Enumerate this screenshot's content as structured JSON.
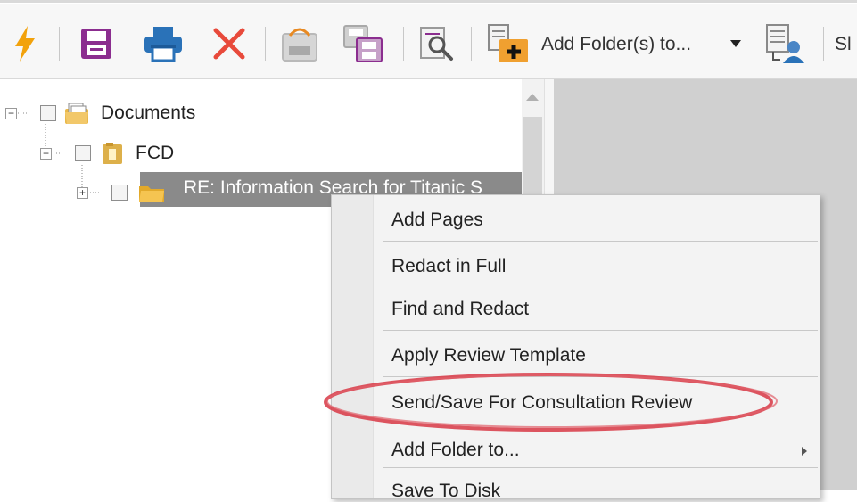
{
  "toolbar": {
    "add_folder_label": "Add Folder(s) to...",
    "cut_off_label": "Sl",
    "icons": [
      "lightning-icon",
      "save-icon",
      "print-icon",
      "delete-icon",
      "redact-page-icon",
      "save-copy-icon",
      "find-redact-icon",
      "add-folder-icon",
      "dropdown-arrow-icon",
      "user-review-icon"
    ]
  },
  "tree": {
    "root": "Documents",
    "child": "FCD",
    "selected": "RE: Information Search for Titanic S"
  },
  "context_menu": {
    "items": [
      "Add Pages",
      "Redact in Full",
      "Find and Redact",
      "Apply Review Template",
      "Send/Save For Consultation Review",
      "Add Folder to...",
      "Save To Disk"
    ],
    "highlighted": "Send/Save For Consultation Review"
  },
  "colors": {
    "highlight_ellipse": "#d9434f",
    "selection": "#8a8a8a",
    "accent_purple": "#8b2d8f",
    "accent_blue": "#2a72b8"
  }
}
